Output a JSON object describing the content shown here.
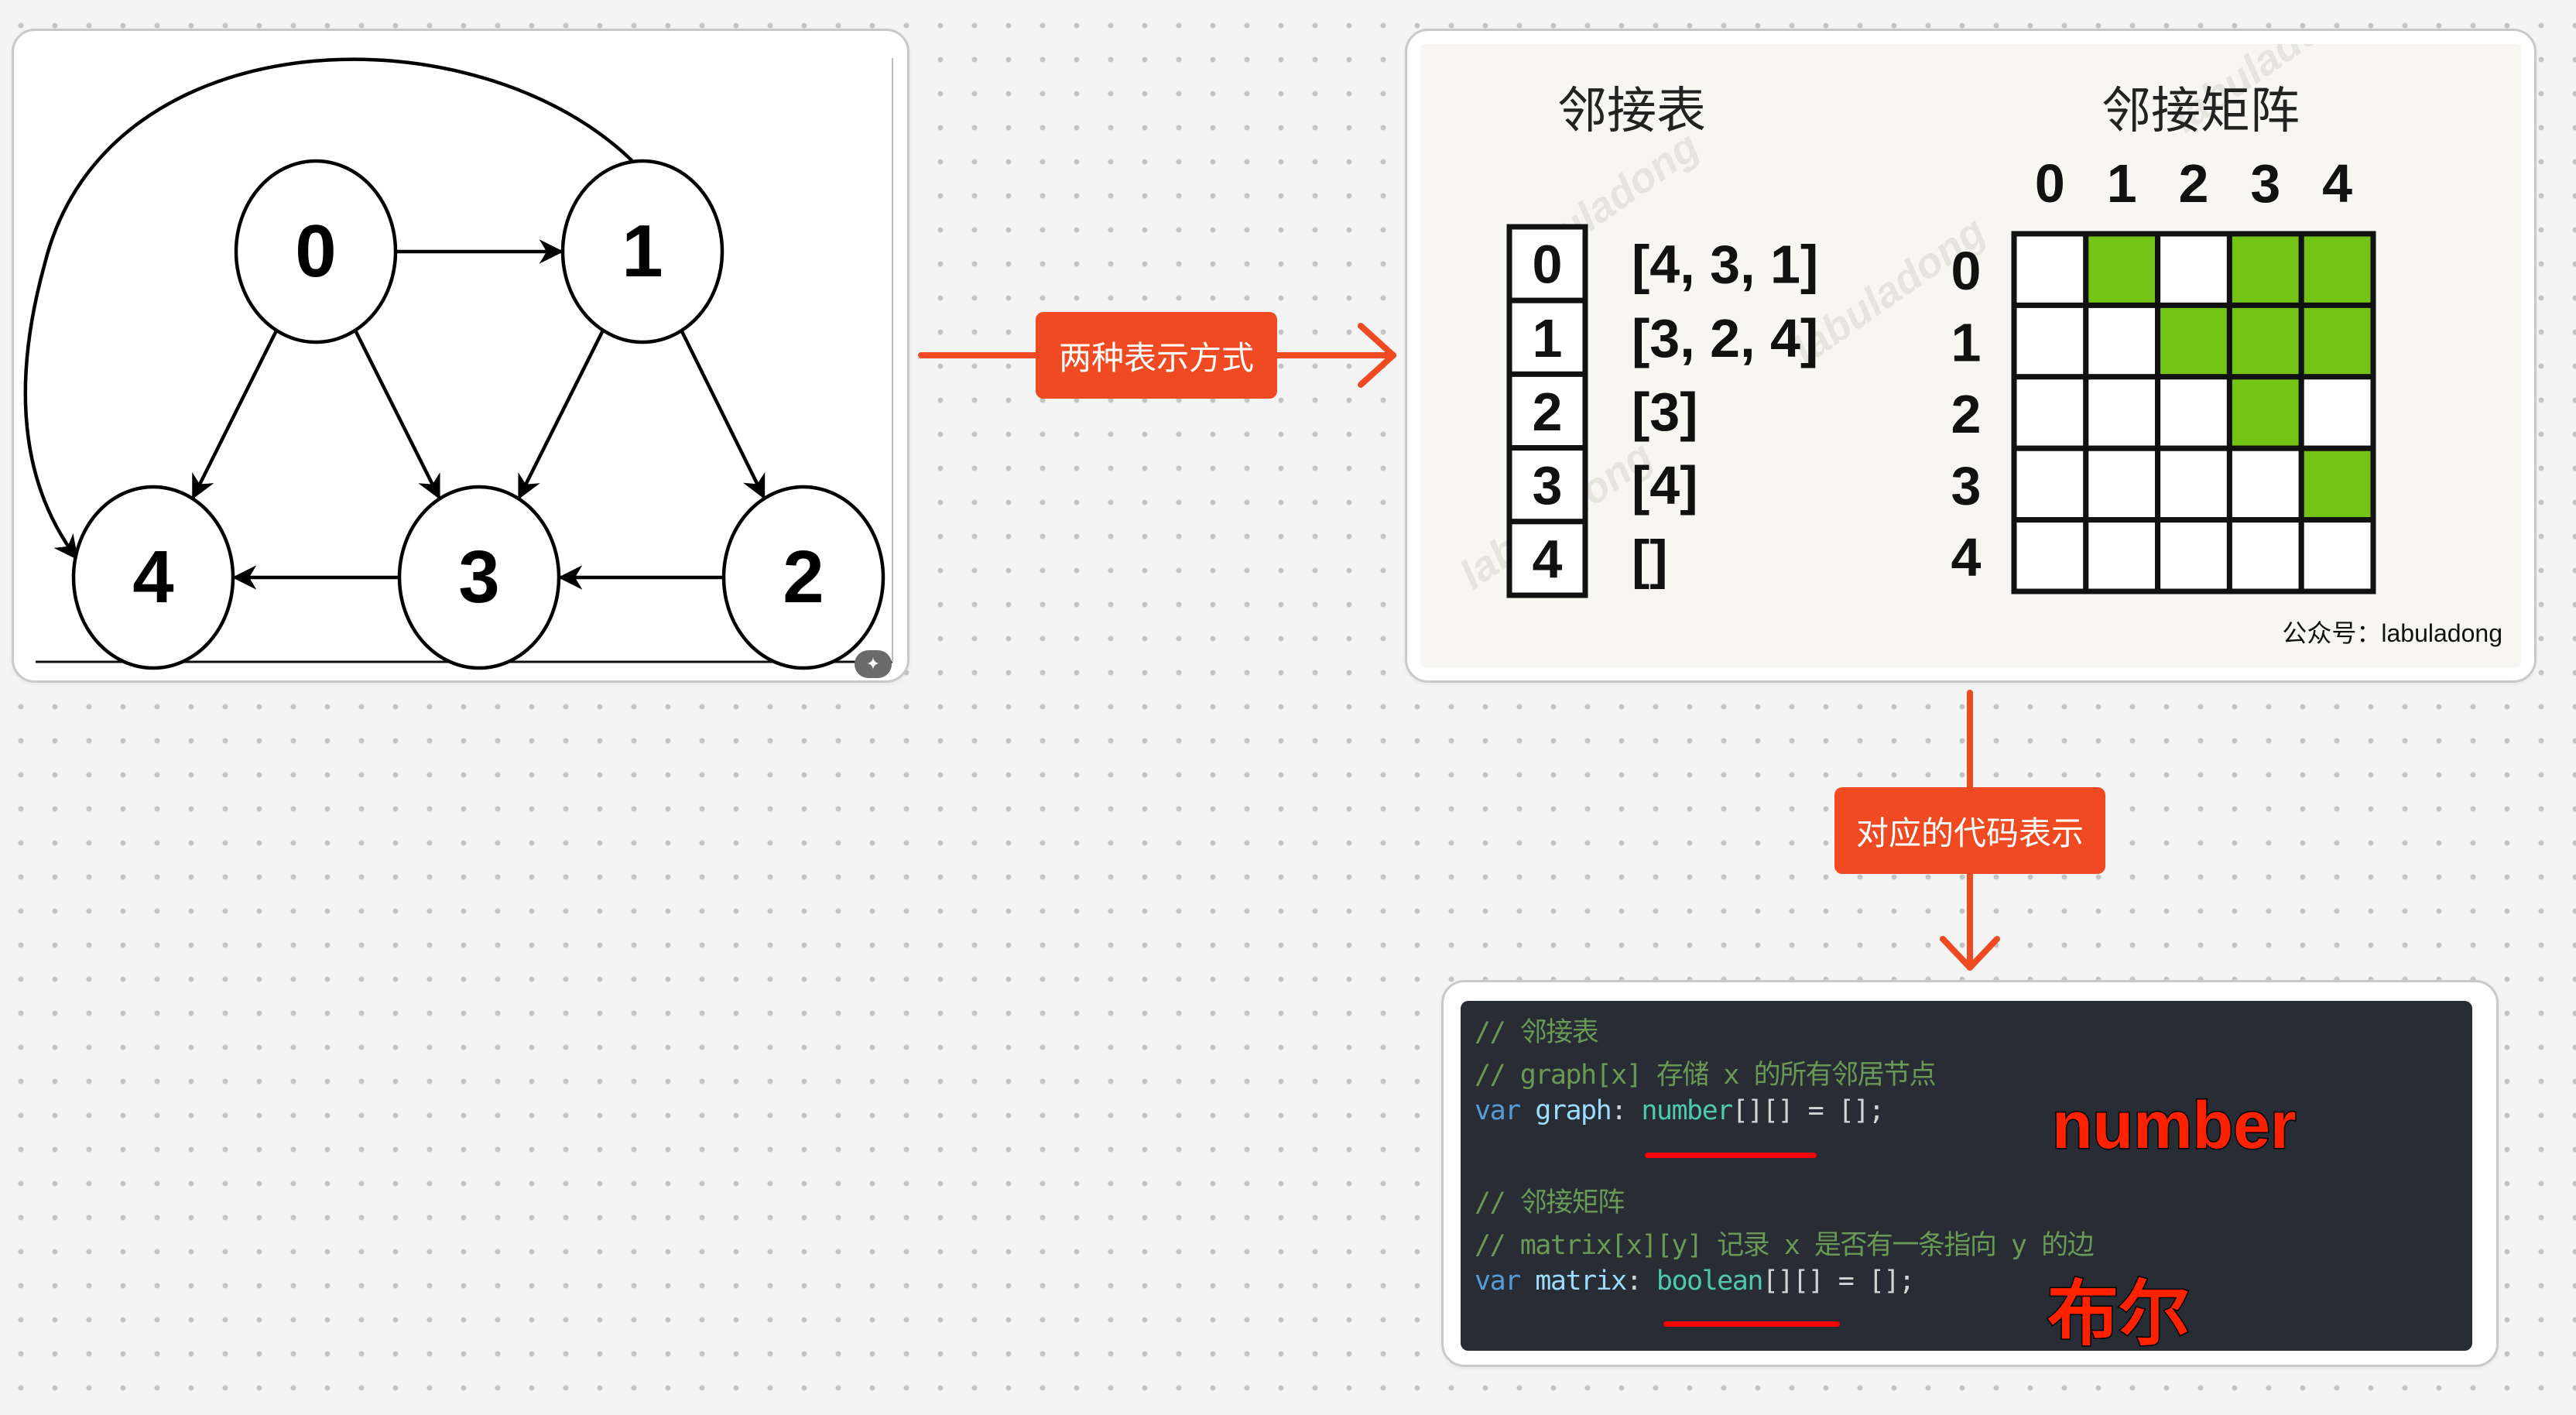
{
  "graph": {
    "nodes": [
      {
        "id": "0",
        "label": "0"
      },
      {
        "id": "1",
        "label": "1"
      },
      {
        "id": "2",
        "label": "2"
      },
      {
        "id": "3",
        "label": "3"
      },
      {
        "id": "4",
        "label": "4"
      }
    ],
    "edges": [
      {
        "from": "0",
        "to": "1"
      },
      {
        "from": "0",
        "to": "4"
      },
      {
        "from": "0",
        "to": "3"
      },
      {
        "from": "1",
        "to": "3"
      },
      {
        "from": "1",
        "to": "2"
      },
      {
        "from": "1",
        "to": "4",
        "curved": true
      },
      {
        "from": "2",
        "to": "3"
      },
      {
        "from": "3",
        "to": "4"
      }
    ],
    "badge_icon": "magic-wand-icon"
  },
  "connectors": {
    "two_ways_label": "两种表示方式",
    "code_label": "对应的代码表示",
    "color": "#f04a22"
  },
  "representations": {
    "adj_list_title": "邻接表",
    "adj_matrix_title": "邻接矩阵",
    "adj_list": [
      {
        "index": "0",
        "neighbors": "[4, 3, 1]"
      },
      {
        "index": "1",
        "neighbors": "[3, 2, 4]"
      },
      {
        "index": "2",
        "neighbors": "[3]"
      },
      {
        "index": "3",
        "neighbors": "[4]"
      },
      {
        "index": "4",
        "neighbors": "[]"
      }
    ],
    "matrix_col_labels": [
      "0",
      "1",
      "2",
      "3",
      "4"
    ],
    "matrix_row_labels": [
      "0",
      "1",
      "2",
      "3",
      "4"
    ],
    "matrix": [
      [
        0,
        1,
        0,
        1,
        1
      ],
      [
        0,
        0,
        1,
        1,
        1
      ],
      [
        0,
        0,
        0,
        1,
        0
      ],
      [
        0,
        0,
        0,
        0,
        1
      ],
      [
        0,
        0,
        0,
        0,
        0
      ]
    ],
    "filled_color": "#73c415",
    "watermark": "labuladong",
    "footer": "公众号：labuladong"
  },
  "code": {
    "lines": [
      [
        {
          "t": "// 邻接表",
          "c": "comment"
        }
      ],
      [
        {
          "t": "// graph[x] 存储 x 的所有邻居节点",
          "c": "comment"
        }
      ],
      [
        {
          "t": "var",
          "c": "kw"
        },
        {
          "t": " ",
          "c": "punc"
        },
        {
          "t": "graph",
          "c": "var"
        },
        {
          "t": ": ",
          "c": "punc"
        },
        {
          "t": "number",
          "c": "type"
        },
        {
          "t": "[][] = [];",
          "c": "punc"
        }
      ],
      [],
      [
        {
          "t": "// 邻接矩阵",
          "c": "comment"
        }
      ],
      [
        {
          "t": "// matrix[x][y] 记录 x 是否有一条指向 y 的边",
          "c": "comment"
        }
      ],
      [
        {
          "t": "var",
          "c": "kw"
        },
        {
          "t": " ",
          "c": "punc"
        },
        {
          "t": "matrix",
          "c": "var"
        },
        {
          "t": ": ",
          "c": "punc"
        },
        {
          "t": "boolean",
          "c": "type"
        },
        {
          "t": "[][] = [];",
          "c": "punc"
        }
      ]
    ],
    "annotation_number": "number",
    "annotation_boolean": "布尔"
  }
}
